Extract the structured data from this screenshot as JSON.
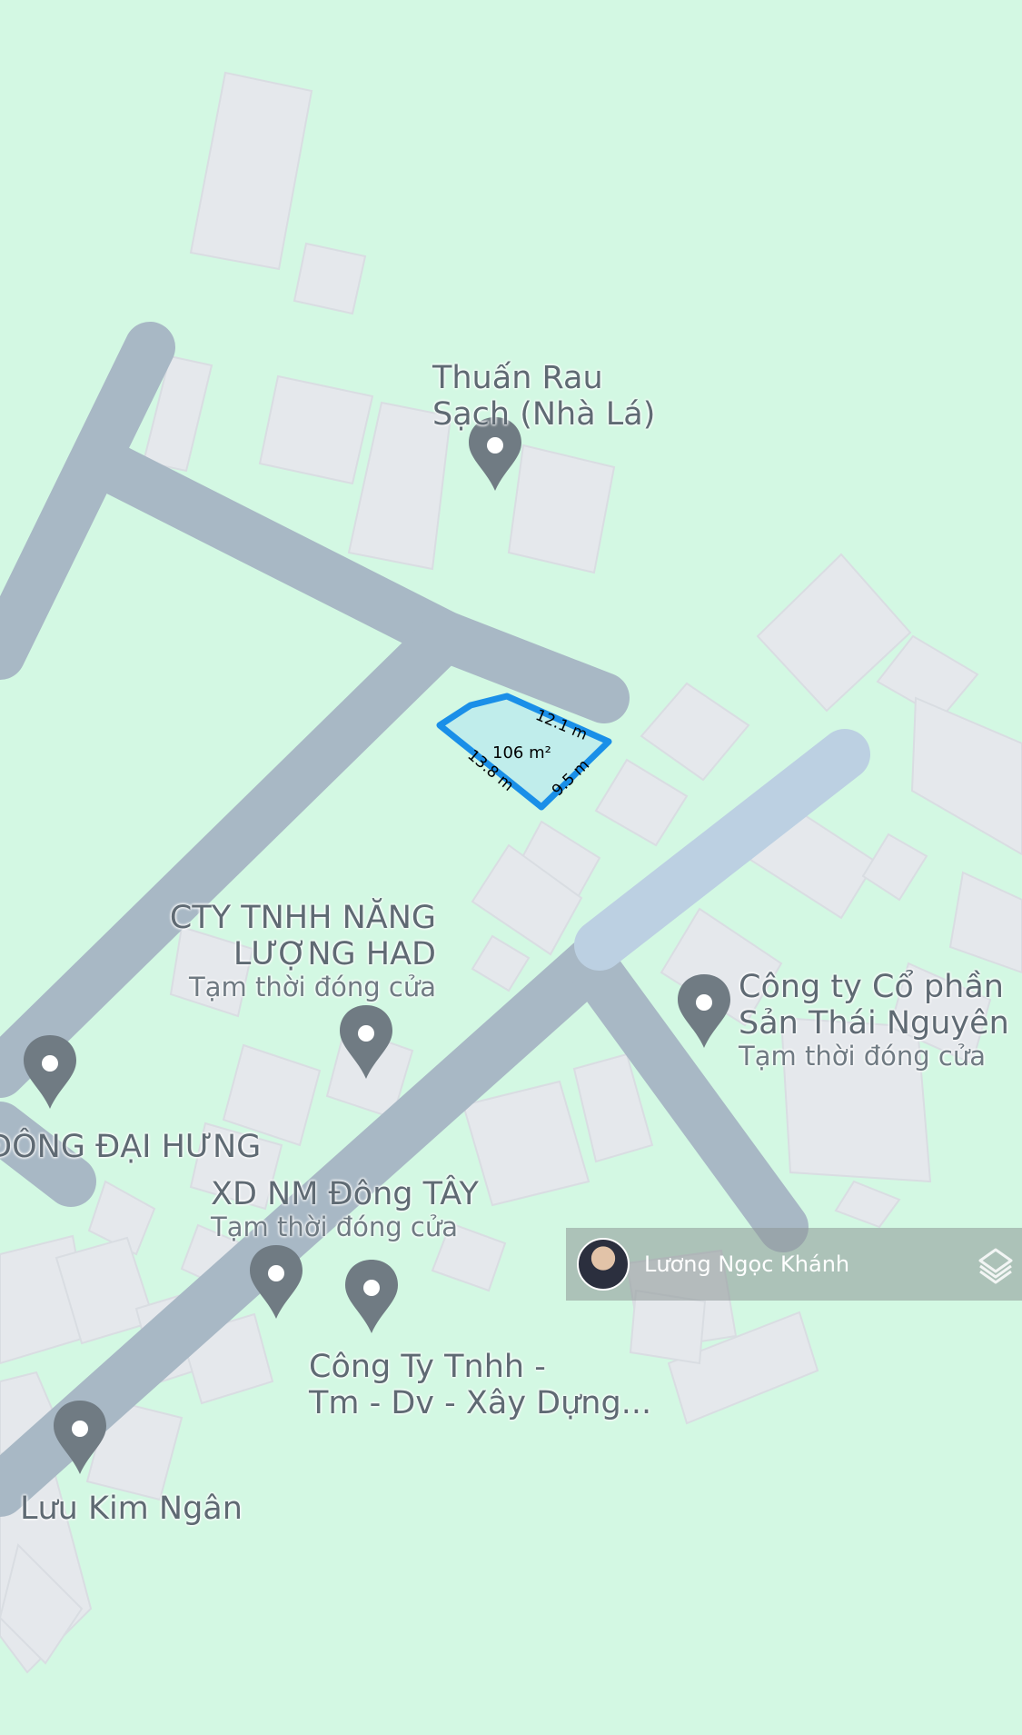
{
  "map": {
    "colors": {
      "land": "#d3f8e3",
      "building": "#e5e8ec",
      "road": "#a8b8c5",
      "road_highlight": "#bcd0e2",
      "parcel_fill": "#b8e8ee",
      "parcel_stroke": "#1a8fe8",
      "pin": "#707b83"
    },
    "parcel": {
      "area": "106 m²",
      "sides": [
        "12.1 m",
        "9.5 m",
        "13.8 m"
      ]
    },
    "pois": [
      {
        "name": "Thuấn Rau Sạch (Nhà Lá)",
        "line1": "Thuấn Rau",
        "line2": "Sạch (Nhà Lá)",
        "status": ""
      },
      {
        "name": "CTY TNHH NĂNG LƯỢNG HAD",
        "line1": "CTY TNHH NĂNG",
        "line2": "LƯỢNG HAD",
        "status": "Tạm thời đóng cửa"
      },
      {
        "name": "Công ty Cổ phần Sản Thái Nguyên",
        "line1": "Công ty Cổ phần",
        "line2": "Sản Thái Nguyên",
        "status": "Tạm thời đóng cửa"
      },
      {
        "name": "ĐÔNG ĐẠI HƯNG",
        "line1": "ĐÔNG ĐẠI HƯNG",
        "line2": "",
        "status": ""
      },
      {
        "name": "XD NM Đông TÂY",
        "line1": "XD NM Đông TÂY",
        "line2": "",
        "status": "Tạm thời đóng cửa"
      },
      {
        "name": "Công Ty Tnhh - Tm - Dv - Xây Dựng...",
        "line1": "Công Ty Tnhh -",
        "line2": "Tm - Dv - Xây Dựng...",
        "status": ""
      },
      {
        "name": "Lưu Kim Ngân",
        "line1": "Lưu Kim Ngân",
        "line2": "",
        "status": ""
      }
    ]
  },
  "agent": {
    "name": "Lương Ngọc Khánh",
    "icon": "layers-watermark-icon"
  }
}
